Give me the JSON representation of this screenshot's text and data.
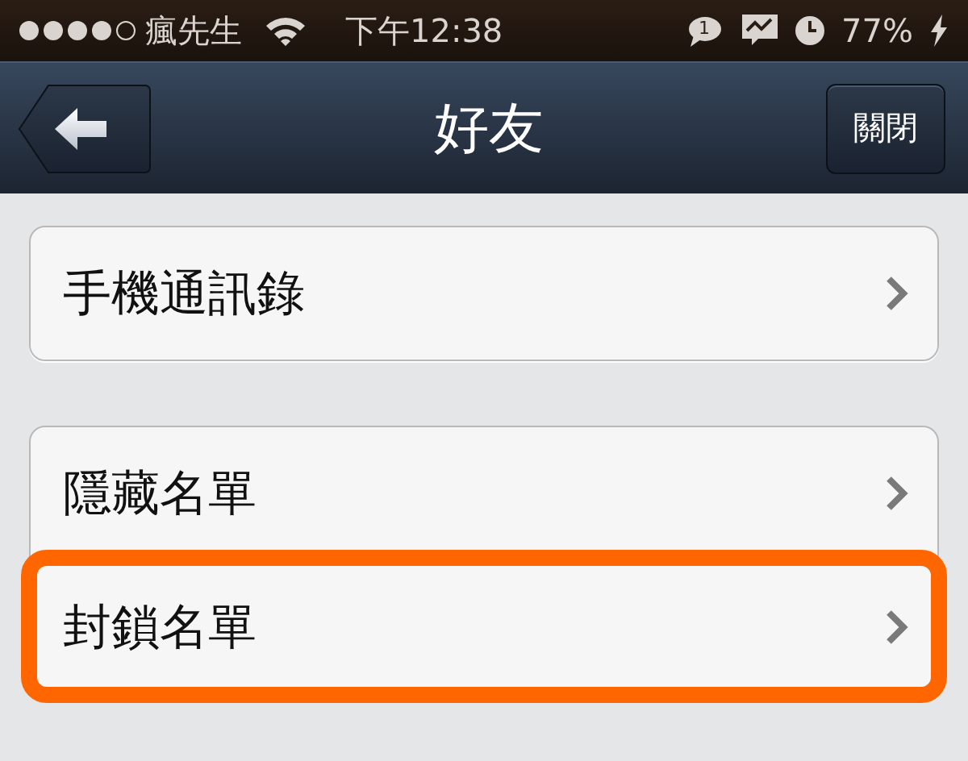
{
  "status_bar": {
    "carrier": "瘋先生",
    "time": "下午12:38",
    "notification_count": "1",
    "battery": "77%"
  },
  "nav_bar": {
    "title": "好友",
    "close_button": "關閉"
  },
  "groups": [
    {
      "items": [
        {
          "label": "手機通訊錄",
          "highlighted": false
        }
      ]
    },
    {
      "items": [
        {
          "label": "隱藏名單",
          "highlighted": false
        },
        {
          "label": "封鎖名單",
          "highlighted": true
        }
      ]
    }
  ]
}
